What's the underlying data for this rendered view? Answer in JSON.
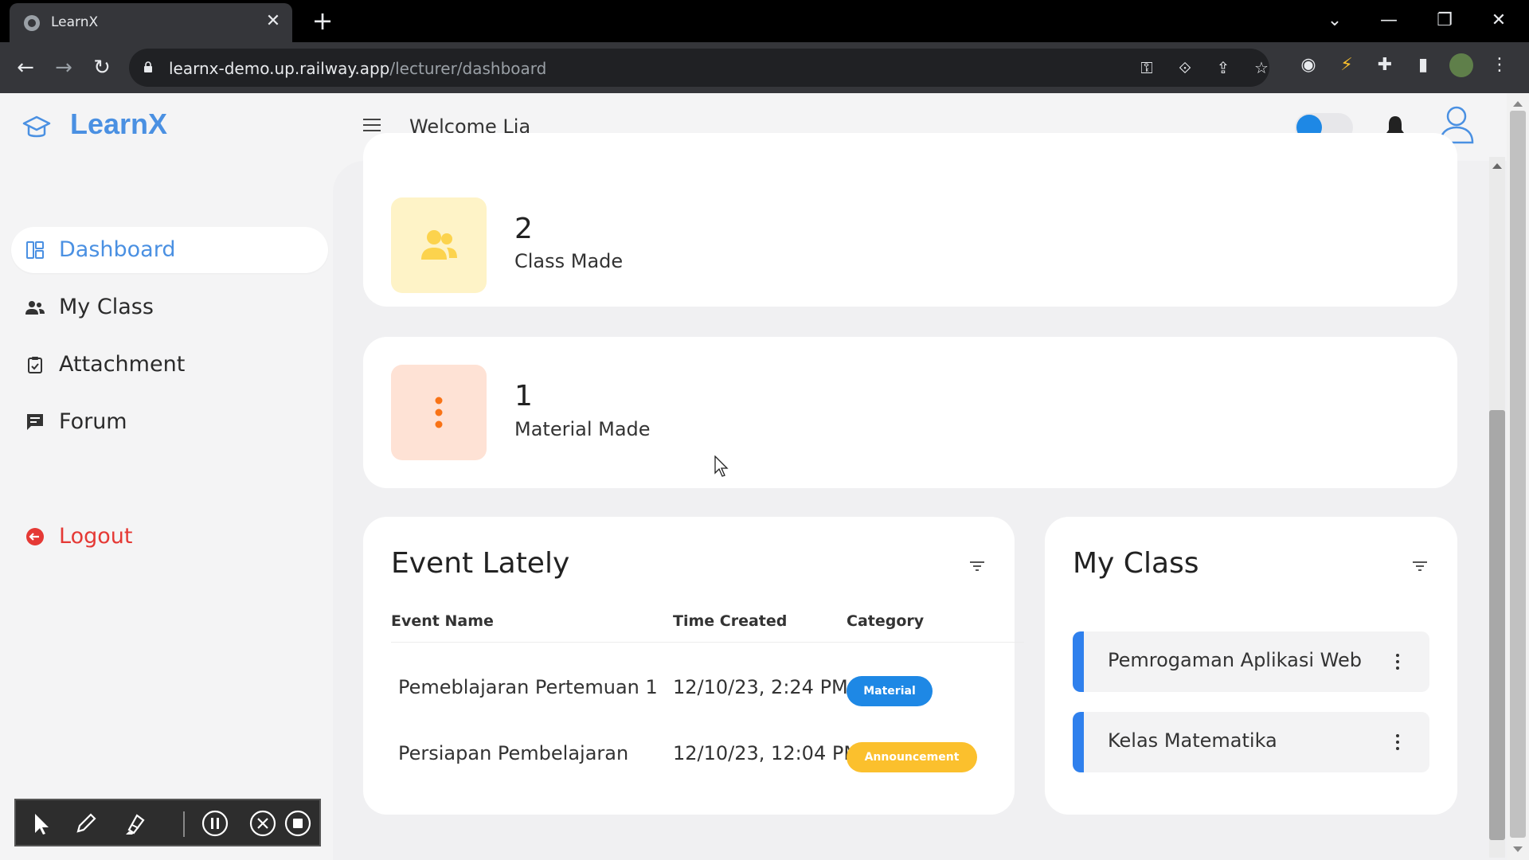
{
  "browser": {
    "tab_title": "LearnX",
    "url_host": "learnx-demo.up.railway.app",
    "url_path": "/lecturer/dashboard",
    "new_tab_label": "+",
    "close_label": "✕"
  },
  "app": {
    "brand": "LearnX",
    "welcome": "Welcome Lia",
    "theme_toggle_on": true
  },
  "sidebar": {
    "items": [
      {
        "label": "Dashboard",
        "icon": "dashboard-icon",
        "active": true
      },
      {
        "label": "My Class",
        "icon": "users-icon",
        "active": false
      },
      {
        "label": "Attachment",
        "icon": "clipboard-icon",
        "active": false
      },
      {
        "label": "Forum",
        "icon": "chat-icon",
        "active": false
      }
    ],
    "logout": {
      "label": "Logout",
      "icon": "logout-icon"
    }
  },
  "stats": [
    {
      "number": "2",
      "label": "Class Made",
      "icon": "users-icon",
      "color": "#fcd34d",
      "bg": "#fef3c7"
    },
    {
      "number": "1",
      "label": "Material Made",
      "icon": "dots-vertical-icon",
      "color": "#f97316",
      "bg": "#fee2d5"
    }
  ],
  "events": {
    "title": "Event Lately",
    "headers": [
      "Event Name",
      "Time Created",
      "Category"
    ],
    "rows": [
      {
        "name": "Pemeblajaran Pertemuan 1",
        "time": "12/10/23, 2:24 PM",
        "category": "Material",
        "badge_color": "#1e88e5"
      },
      {
        "name": "Persiapan Pembelajaran",
        "time": "12/10/23, 12:04 PM",
        "category": "Announcement",
        "badge_color": "#fbc02d"
      }
    ]
  },
  "my_class": {
    "title": "My Class",
    "items": [
      "Pemrogaman Aplikasi Web",
      "Kelas Matematika"
    ]
  },
  "colors": {
    "accent": "#4a90e2",
    "danger": "#e53935"
  }
}
